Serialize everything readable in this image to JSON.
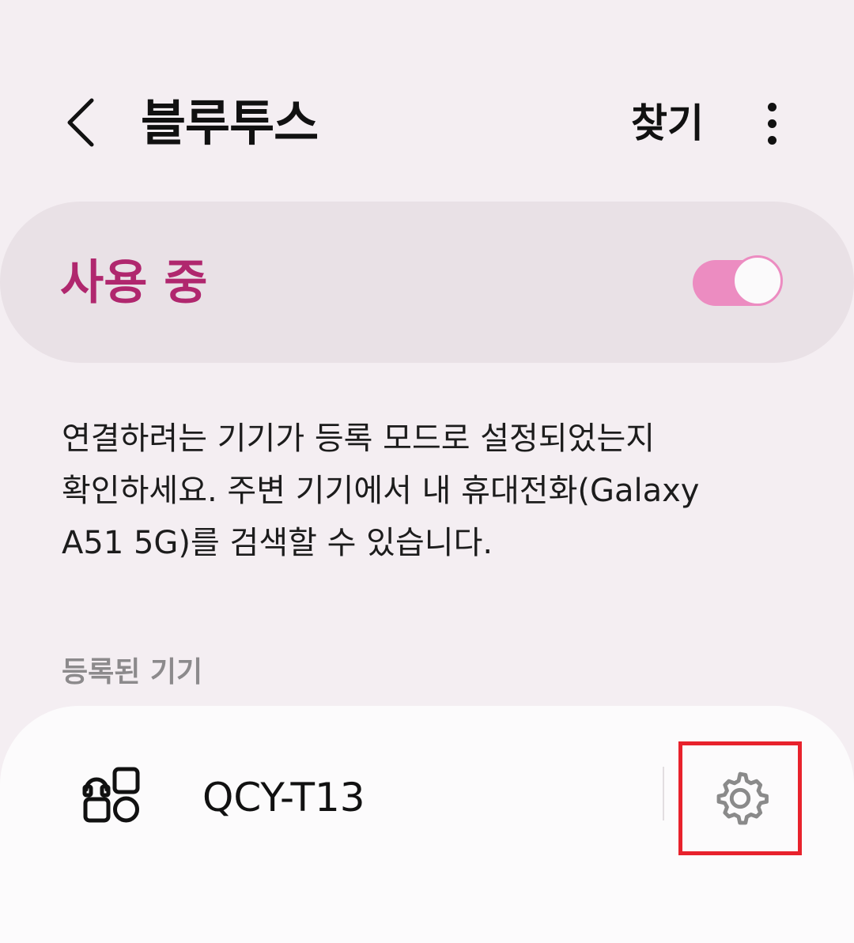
{
  "header": {
    "back_icon": "chevron-left-icon",
    "title": "블루투스",
    "search_label": "찾기",
    "more_icon": "more-vertical-icon"
  },
  "master_switch": {
    "label": "사용 중",
    "state": "on",
    "accent_color": "#b0276e",
    "track_color": "#ec8cc1"
  },
  "description": {
    "lines": [
      "연결하려는 기기가 등록 모드로 설정되었는지",
      "확인하세요. 주변 기기에서 내 휴대전화(Galaxy",
      "A51 5G)를 검색할 수 있습니다."
    ]
  },
  "paired_section": {
    "header": "등록된 기기",
    "devices": [
      {
        "name": "QCY-T13",
        "icon": "earbuds-icon",
        "settings_icon": "gear-icon"
      }
    ]
  },
  "highlight_color": "#e8222c"
}
